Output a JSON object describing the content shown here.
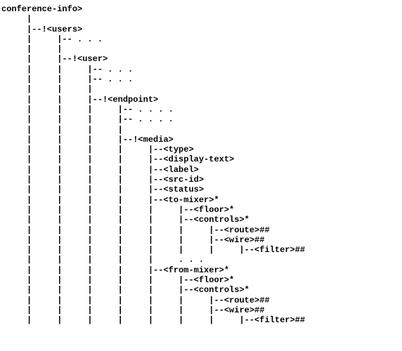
{
  "root": "conference-info>",
  "lines": [
    "     |",
    "     |--!<users>",
    "     |     |-- . . .",
    "     |     |",
    "     |     |--!<user>",
    "     |     |     |-- . . .",
    "     |     |     |-- . . .",
    "     |     |     |",
    "     |     |     |--!<endpoint>",
    "     |     |     |     |-- . . . .",
    "     |     |     |     |-- . . . .",
    "     |     |     |     |",
    "     |     |     |     |--!<media>",
    "     |     |     |     |     |--<type>",
    "     |     |     |     |     |--<display-text>",
    "     |     |     |     |     |--<label>",
    "     |     |     |     |     |--<src-id>",
    "     |     |     |     |     |--<status>",
    "     |     |     |     |     |--<to-mixer>*",
    "     |     |     |     |     |     |--<floor>*",
    "     |     |     |     |     |     |--<controls>*",
    "     |     |     |     |     |     |     |--<route>##",
    "     |     |     |     |     |     |     |--<wire>##",
    "     |     |     |     |     |     |     |     |--<filter>##",
    "     |     |     |     |     |     . . .",
    "     |     |     |     |     |--<from-mixer>*",
    "     |     |     |     |     |     |--<floor>*",
    "     |     |     |     |     |     |--<controls>*",
    "     |     |     |     |     |     |     |--<route>##",
    "     |     |     |     |     |     |     |--<wire>##",
    "     |     |     |     |     |     |     |     |--<filter>##"
  ]
}
